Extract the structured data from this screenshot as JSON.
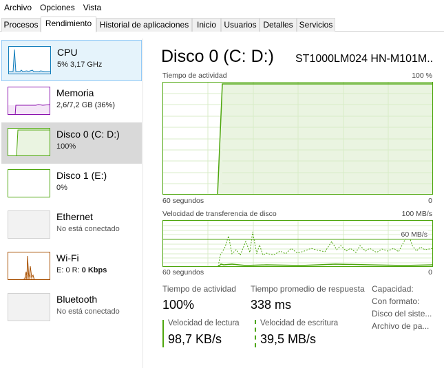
{
  "menu": {
    "items": [
      "Archivo",
      "Opciones",
      "Vista"
    ]
  },
  "tabs": [
    "Procesos",
    "Rendimiento",
    "Historial de aplicaciones",
    "Inicio",
    "Usuarios",
    "Detalles",
    "Servicios"
  ],
  "active_tab": "Rendimiento",
  "sidebar": {
    "items": [
      {
        "name": "CPU",
        "sub": "5%  3,17 GHz",
        "color": "#117dbb"
      },
      {
        "name": "Memoria",
        "sub": "2,6/7,2 GB (36%)",
        "color": "#8b12ae"
      },
      {
        "name": "Disco 0 (C: D:)",
        "sub": "100%",
        "color": "#4da60c"
      },
      {
        "name": "Disco 1 (E:)",
        "sub": "0%",
        "color": "#4da60c"
      },
      {
        "name": "Ethernet",
        "sub": "No está conectado",
        "color": "#c8c8c8"
      },
      {
        "name": "Wi-Fi",
        "sub": "E: 0 R: 0 Kbps",
        "sub_prefix": "E: 0 R: ",
        "sub_bold": "0 Kbps",
        "color": "#a74f01"
      },
      {
        "name": "Bluetooth",
        "sub": "No está conectado",
        "color": "#c8c8c8"
      }
    ]
  },
  "detail": {
    "title": "Disco 0 (C: D:)",
    "model": "ST1000LM024 HN-M101M...",
    "accent": "#4da60c",
    "activity_chart": {
      "label": "Tiempo de actividad",
      "max_label": "100 %",
      "time_label": "60 segundos",
      "min_label": "0"
    },
    "transfer_chart": {
      "label": "Velocidad de transferencia de disco",
      "max_label": "100 MB/s",
      "mark_label": "60 MB/s",
      "time_label": "60 segundos",
      "min_label": "0"
    },
    "stats": {
      "activity_label": "Tiempo de actividad",
      "activity_value": "100%",
      "response_label": "Tiempo promedio de respuesta",
      "response_value": "338 ms",
      "read_label": "Velocidad de lectura",
      "read_value": "98,7 KB/s",
      "write_label": "Velocidad de escritura",
      "write_value": "39,5 MB/s"
    },
    "properties": [
      "Capacidad:",
      "Con formato:",
      "Disco del siste...",
      "Archivo de pa..."
    ]
  }
}
